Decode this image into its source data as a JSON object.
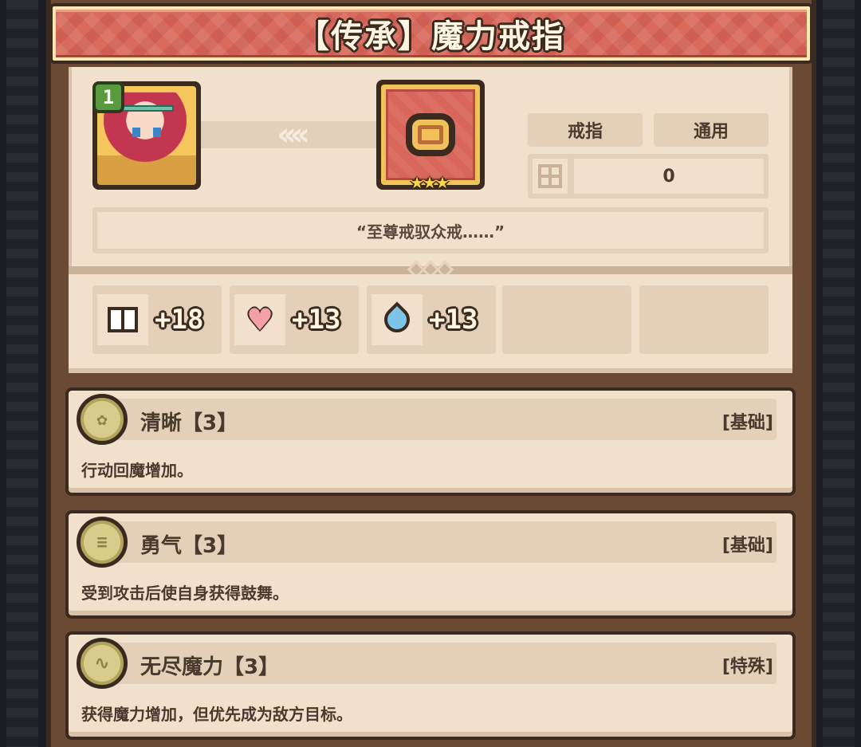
{
  "title": "【传承】魔力戒指",
  "hero": {
    "level": "1"
  },
  "item": {
    "stars": "★★★"
  },
  "tags": [
    "戒指",
    "通用"
  ],
  "counter": {
    "value": "0"
  },
  "quote": "“至尊戒驭众戒……”",
  "stats": [
    {
      "icon": "book-icon",
      "value": "+18"
    },
    {
      "icon": "heart-icon",
      "value": "+13"
    },
    {
      "icon": "mana-drop-icon",
      "value": "+13"
    }
  ],
  "skills": [
    {
      "icon_glyph": "✿",
      "name": "清晰【3】",
      "type": "[基础]",
      "desc": "行动回魔增加。"
    },
    {
      "icon_glyph": "≡",
      "name": "勇气【3】",
      "type": "[基础]",
      "desc": "受到攻击后使自身获得鼓舞。"
    },
    {
      "icon_glyph": "∿",
      "name": "无尽魔力【3】",
      "type": "[特殊]",
      "desc": "获得魔力增加，但优先成为敌方目标。"
    }
  ]
}
